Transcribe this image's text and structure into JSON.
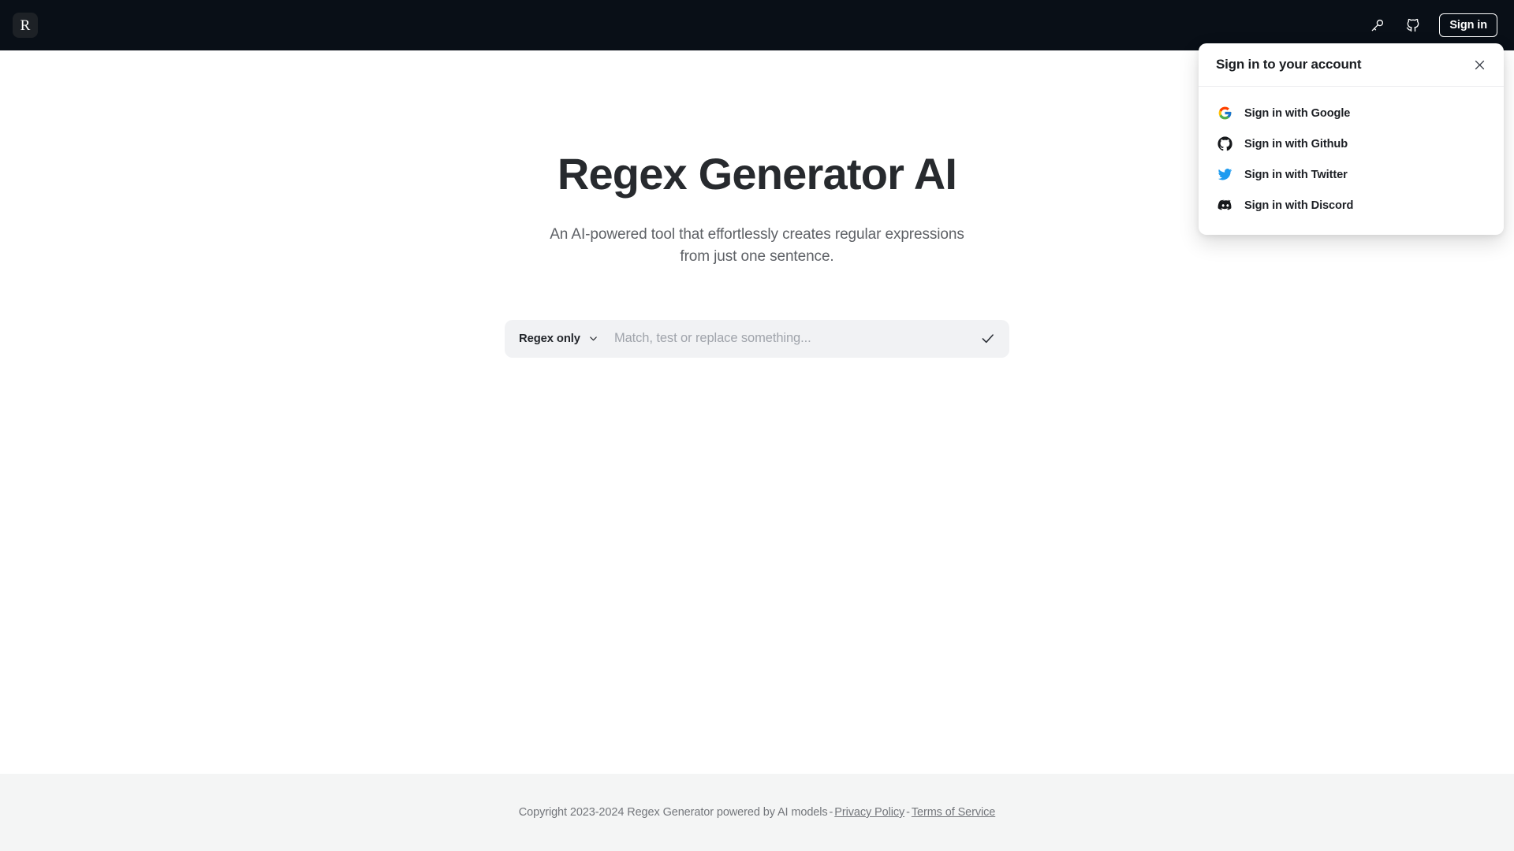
{
  "header": {
    "logo_letter": "R",
    "logo_name": "app-logo",
    "icons": [
      {
        "name": "key-icon",
        "label": "API key"
      },
      {
        "name": "github-icon",
        "label": "Github"
      }
    ],
    "signin_label": "Sign in"
  },
  "signin_panel": {
    "title": "Sign in to your account",
    "close_label": "Close",
    "providers": [
      {
        "icon": "google-icon",
        "label": "Sign in with Google"
      },
      {
        "icon": "github-icon",
        "label": "Sign in with Github"
      },
      {
        "icon": "twitter-icon",
        "label": "Sign in with Twitter"
      },
      {
        "icon": "discord-icon",
        "label": "Sign in with Discord"
      }
    ]
  },
  "main": {
    "title": "Regex Generator AI",
    "subtitle": "An AI-powered tool that effortlessly creates regular expressions from just one sentence.",
    "search": {
      "mode_label": "Regex only",
      "placeholder": "Match, test or replace something...",
      "value": "",
      "submit_name": "check-icon"
    }
  },
  "footer": {
    "copyright": "Copyright 2023-2024 Regex Generator powered by AI models",
    "dash_1": "-",
    "privacy_label": "Privacy Policy",
    "dash_2": "-",
    "terms_label": "Terms of Service"
  },
  "colors": {
    "header_bg": "#090f17",
    "page_bg": "#ffffff",
    "footer_bg": "#f4f5f5",
    "input_bg": "#f1f2f4",
    "text_dark": "#272a2e",
    "text_muted": "#73767b",
    "twitter_blue": "#1d9bf0"
  }
}
